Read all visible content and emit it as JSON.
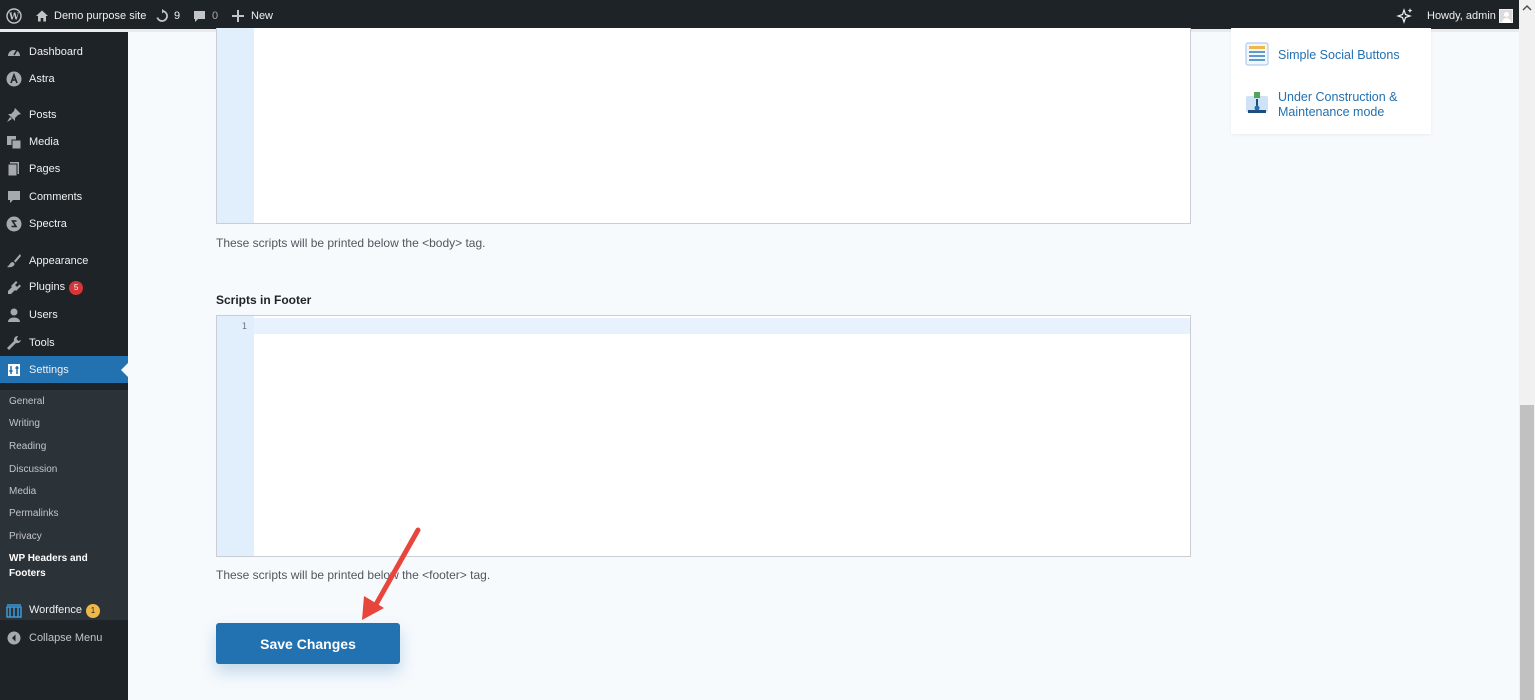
{
  "adminbar": {
    "site_name": "Demo purpose site",
    "updates_count": "9",
    "comments_count": "0",
    "new_label": "New",
    "greeting": "Howdy, admin"
  },
  "sidebar": {
    "items": [
      {
        "label": "Dashboard",
        "icon": "dashboard-icon"
      },
      {
        "label": "Astra",
        "icon": "astra-icon"
      },
      {
        "label": "Posts",
        "icon": "pin-icon"
      },
      {
        "label": "Media",
        "icon": "media-icon"
      },
      {
        "label": "Pages",
        "icon": "pages-icon"
      },
      {
        "label": "Comments",
        "icon": "comment-icon"
      },
      {
        "label": "Spectra",
        "icon": "spectra-icon"
      },
      {
        "label": "Appearance",
        "icon": "brush-icon"
      },
      {
        "label": "Plugins",
        "icon": "plugin-icon",
        "badge": "5"
      },
      {
        "label": "Users",
        "icon": "user-icon"
      },
      {
        "label": "Tools",
        "icon": "wrench-icon"
      },
      {
        "label": "Settings",
        "icon": "settings-icon",
        "active": true
      },
      {
        "label": "Wordfence",
        "icon": "wordfence-icon",
        "badge": "1"
      },
      {
        "label": "Collapse Menu",
        "icon": "collapse-icon"
      }
    ],
    "settings_submenu": [
      "General",
      "Writing",
      "Reading",
      "Discussion",
      "Media",
      "Permalinks",
      "Privacy",
      "WP Headers and Footers"
    ]
  },
  "content": {
    "body_desc": "These scripts will be printed below the <body> tag.",
    "footer_title": "Scripts in Footer",
    "footer_line_number": "1",
    "footer_desc": "These scripts will be printed below the <footer> tag.",
    "save_label": "Save Changes"
  },
  "promo": {
    "items": [
      "Simple Social Buttons",
      "Under Construction & Maintenance mode"
    ]
  },
  "colors": {
    "accent": "#2271b1",
    "sidebar_bg": "#1d2327",
    "arrow": "#e8453c"
  }
}
